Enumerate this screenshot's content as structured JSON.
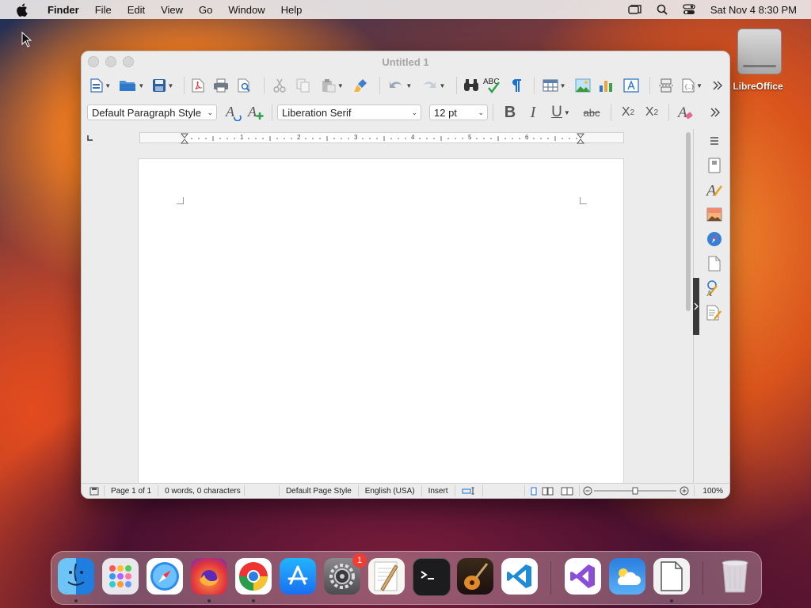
{
  "menubar": {
    "app": "Finder",
    "items": [
      "File",
      "Edit",
      "View",
      "Go",
      "Window",
      "Help"
    ],
    "clock": "Sat Nov 4  8:30 PM",
    "status_icons": [
      "window-icon",
      "search-icon",
      "control-center-icon"
    ]
  },
  "desktop": {
    "drive_label": "LibreOffice"
  },
  "window": {
    "title": "Untitled 1",
    "toolbar_icons": [
      "new-document-icon",
      "open-folder-icon",
      "save-icon",
      "export-pdf-icon",
      "print-icon",
      "print-preview-icon",
      "cut-icon",
      "copy-icon",
      "paste-icon",
      "clone-formatting-icon",
      "undo-icon",
      "redo-icon",
      "find-replace-icon",
      "spelling-icon",
      "formatting-marks-icon",
      "insert-table-icon",
      "insert-image-icon",
      "insert-chart-icon",
      "insert-textbox-icon",
      "page-break-icon",
      "insert-field-icon",
      "more-icon"
    ],
    "spelling_label": "ABC",
    "formatting": {
      "paragraph_style": "Default Paragraph Style",
      "font_name": "Liberation Serif",
      "font_size": "12 pt",
      "bold": "B",
      "italic": "I",
      "underline": "U",
      "strikethrough": "abc",
      "superscript": "X",
      "superscript_mark": "2",
      "subscript": "X",
      "subscript_mark": "2"
    },
    "ruler_numbers": [
      "1",
      "2",
      "3",
      "4",
      "5",
      "6"
    ],
    "status": {
      "page": "Page 1 of 1",
      "words": "0 words, 0 characters",
      "page_style": "Default Page Style",
      "language": "English (USA)",
      "mode": "Insert",
      "zoom": "100%"
    },
    "sidebar_icons": [
      "sidebar-menu-icon",
      "properties-icon",
      "styles-icon",
      "gallery-icon",
      "navigator-icon",
      "page-icon",
      "style-inspector-icon",
      "manage-changes-icon"
    ]
  },
  "dock": {
    "apps": [
      "Finder",
      "Launchpad",
      "Safari",
      "Firefox",
      "Chrome",
      "App Store",
      "System Settings",
      "TextEdit",
      "Terminal",
      "GarageBand",
      "Visual Studio Code",
      "Visual Studio",
      "Weather",
      "LibreOffice",
      "Trash"
    ],
    "settings_badge": "1"
  },
  "colors": {
    "accent_blue": "#1a6fd6",
    "badge_red": "#f23c32"
  }
}
